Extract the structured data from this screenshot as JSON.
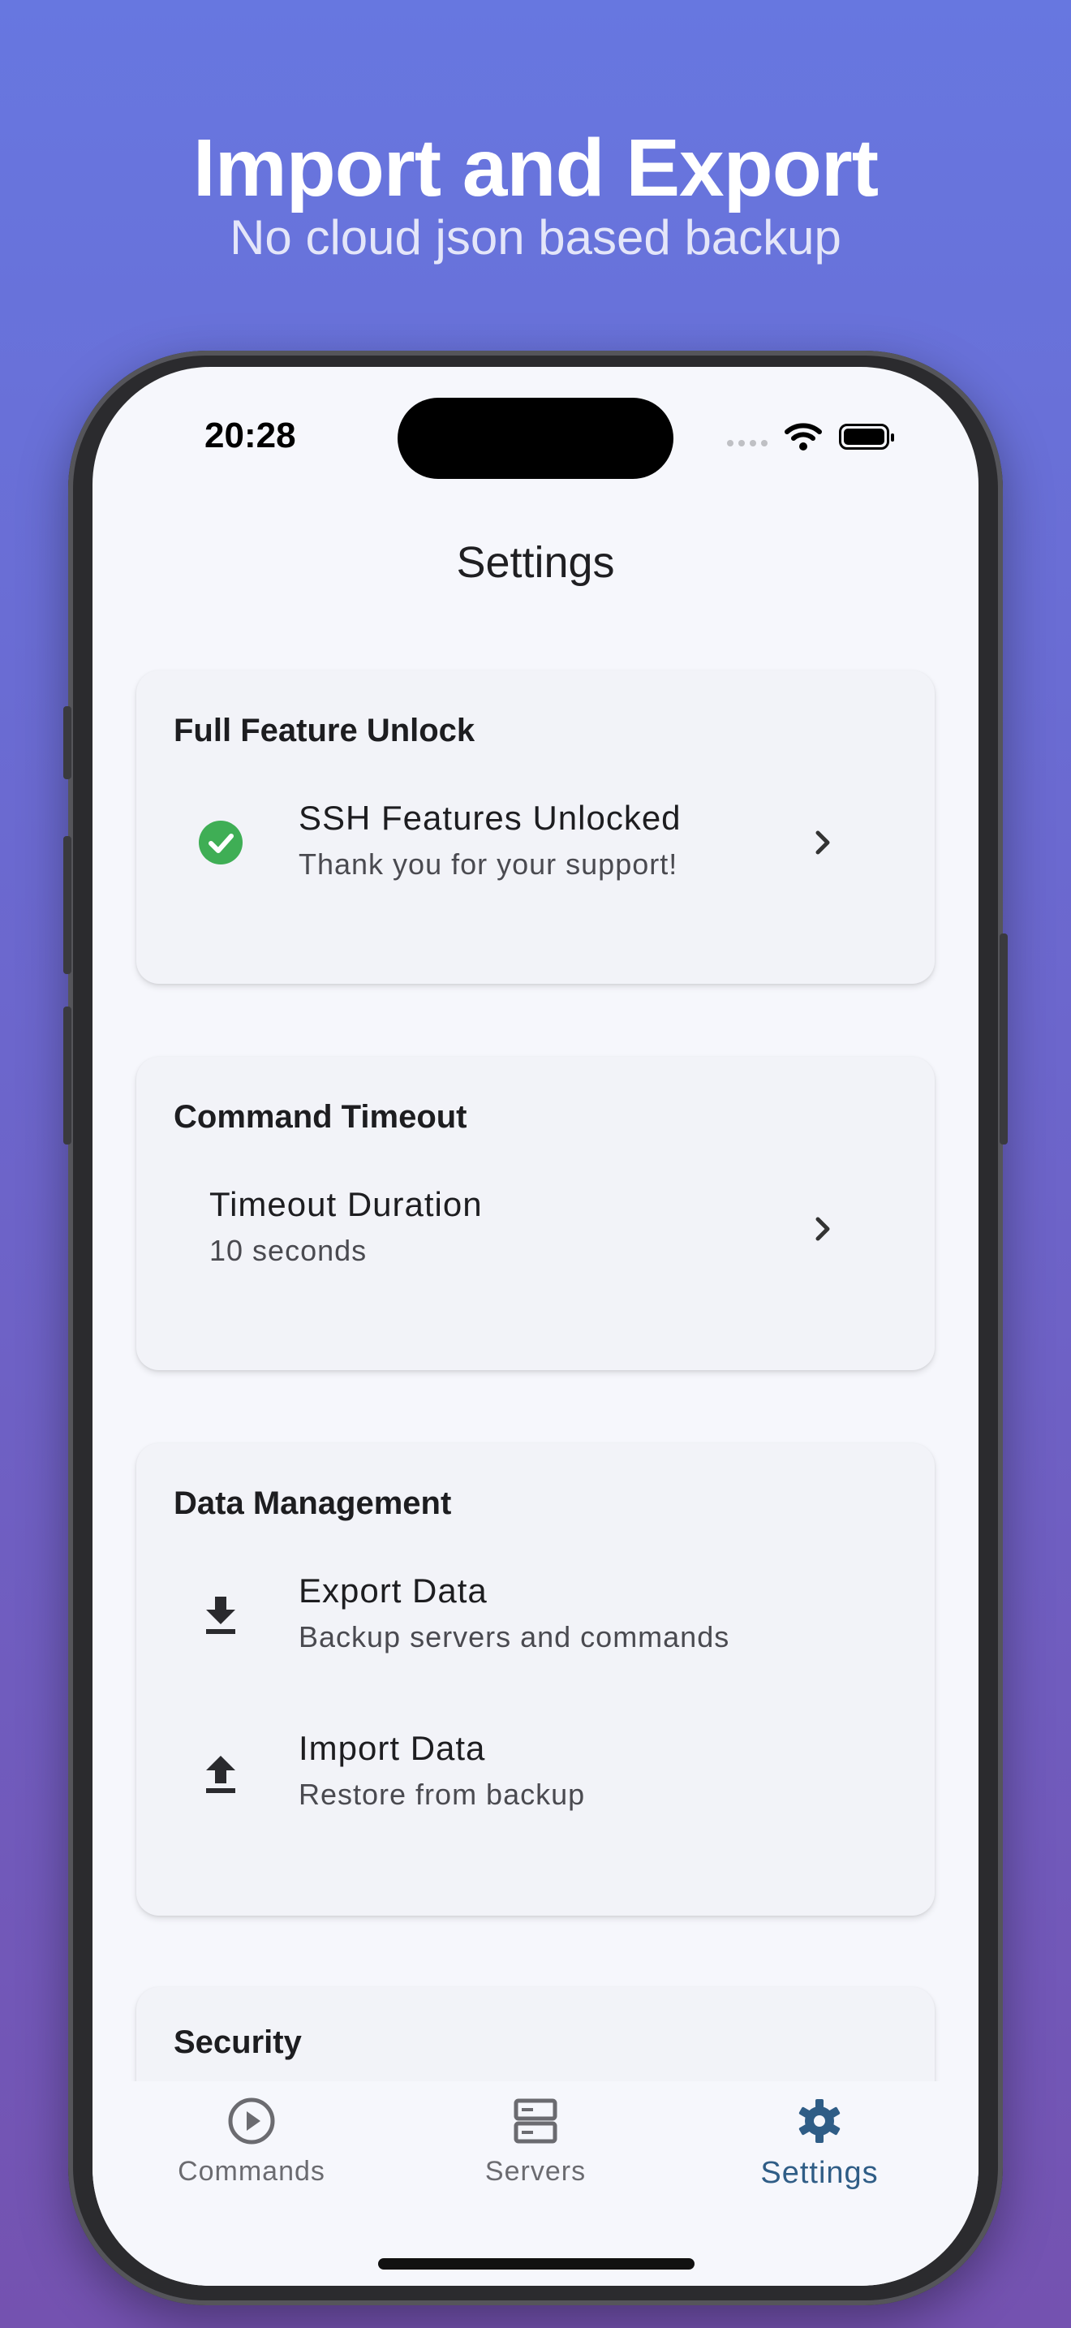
{
  "headline": {
    "title": "Import and Export",
    "subtitle": "No cloud json based backup"
  },
  "status_bar": {
    "time": "20:28",
    "icons": [
      "signal-icon",
      "wifi-icon",
      "battery-icon"
    ]
  },
  "nav": {
    "title": "Settings"
  },
  "sections": {
    "unlock": {
      "title": "Full Feature Unlock",
      "row": {
        "title": "SSH Features Unlocked",
        "subtitle": "Thank you for your support!",
        "icon": "check-circle-icon",
        "icon_color": "#3fae55"
      }
    },
    "timeout": {
      "title": "Command Timeout",
      "row": {
        "title": "Timeout Duration",
        "subtitle": "10 seconds"
      }
    },
    "data": {
      "title": "Data Management",
      "export": {
        "title": "Export Data",
        "subtitle": "Backup servers and commands",
        "icon": "download-icon"
      },
      "import": {
        "title": "Import Data",
        "subtitle": "Restore from backup",
        "icon": "upload-icon"
      }
    },
    "security": {
      "title": "Security"
    }
  },
  "tabbar": {
    "items": [
      {
        "label": "Commands",
        "icon": "play-circle-icon"
      },
      {
        "label": "Servers",
        "icon": "server-icon"
      },
      {
        "label": "Settings",
        "icon": "gear-icon"
      }
    ],
    "active": "Settings",
    "active_color": "#2f5d86",
    "inactive_color": "#6b6b70"
  },
  "colors": {
    "background_top": "#6777e0",
    "background_bottom": "#7452b0",
    "card": "#f2f3f8"
  }
}
